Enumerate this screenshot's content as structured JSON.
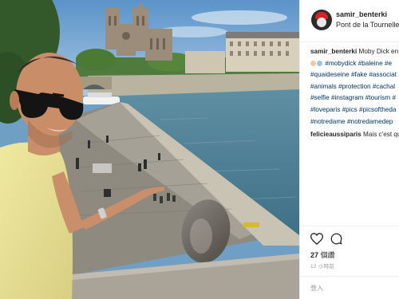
{
  "post": {
    "username": "samir_benterki",
    "location": "Pont de la Tournelle"
  },
  "caption": {
    "username": "samir_benterki",
    "first_line_text": "Moby Dick en",
    "lines": [
      [
        "#mobydick",
        "#baleine",
        "#e"
      ],
      [
        "#quaideseine",
        "#fake",
        "#associat"
      ],
      [
        "#animals",
        "#protection",
        "#cachal"
      ],
      [
        "#selfie",
        "#instagram",
        "#tourism",
        "#"
      ],
      [
        "#loveparis",
        "#pics",
        "#picsoftheda"
      ],
      [
        "#notredame",
        "#notredamedep"
      ]
    ]
  },
  "comment": {
    "username": "felicieaussiparis",
    "text": "Mais c'est qu"
  },
  "actions": {
    "heart_icon": "heart-icon",
    "comment_icon": "comment-bubble-icon"
  },
  "likes": {
    "count": "27",
    "label": "個讚"
  },
  "timestamp": "12 小時前",
  "login_prompt": "登入",
  "colors": {
    "hashtag": "#003569",
    "text": "#262626",
    "muted": "#999999",
    "divider": "#efefef"
  }
}
